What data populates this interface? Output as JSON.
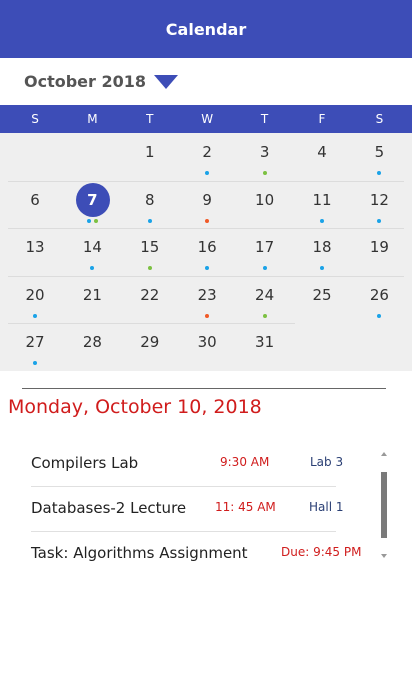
{
  "app": {
    "title": "Calendar"
  },
  "month": {
    "label": "October 2018"
  },
  "weekdays": [
    "S",
    "M",
    "T",
    "W",
    "T",
    "F",
    "S"
  ],
  "calendar": {
    "today": "7",
    "weeks": [
      [
        {
          "d": ""
        },
        {
          "d": ""
        },
        {
          "d": "1"
        },
        {
          "d": "2",
          "dots": [
            "#1aa3e8"
          ]
        },
        {
          "d": "3",
          "dots": [
            "#7cc142"
          ]
        },
        {
          "d": "4"
        },
        {
          "d": "5",
          "dots": [
            "#1aa3e8"
          ]
        }
      ],
      [
        {
          "d": "6"
        },
        {
          "d": "7",
          "dots": [
            "#1aa3e8",
            "#7cc142"
          ]
        },
        {
          "d": "8",
          "dots": [
            "#1aa3e8"
          ]
        },
        {
          "d": "9",
          "dots": [
            "#f05a28"
          ]
        },
        {
          "d": "10"
        },
        {
          "d": "11",
          "dots": [
            "#1aa3e8"
          ]
        },
        {
          "d": "12",
          "dots": [
            "#1aa3e8"
          ]
        }
      ],
      [
        {
          "d": "13"
        },
        {
          "d": "14",
          "dots": [
            "#1aa3e8"
          ]
        },
        {
          "d": "15",
          "dots": [
            "#7cc142"
          ]
        },
        {
          "d": "16",
          "dots": [
            "#1aa3e8"
          ]
        },
        {
          "d": "17",
          "dots": [
            "#1aa3e8"
          ]
        },
        {
          "d": "18",
          "dots": [
            "#1aa3e8"
          ]
        },
        {
          "d": "19"
        }
      ],
      [
        {
          "d": "20",
          "dots": [
            "#1aa3e8"
          ]
        },
        {
          "d": "21"
        },
        {
          "d": "22"
        },
        {
          "d": "23",
          "dots": [
            "#f05a28"
          ]
        },
        {
          "d": "24",
          "dots": [
            "#7cc142"
          ]
        },
        {
          "d": "25"
        },
        {
          "d": "26",
          "dots": [
            "#1aa3e8"
          ]
        }
      ],
      [
        {
          "d": "27",
          "dots": [
            "#1aa3e8"
          ]
        },
        {
          "d": "28"
        },
        {
          "d": "29"
        },
        {
          "d": "30"
        },
        {
          "d": "31"
        },
        {
          "d": ""
        },
        {
          "d": ""
        }
      ]
    ]
  },
  "selected_date": "Monday, October 10, 2018",
  "events": [
    {
      "title": "Compilers Lab",
      "time": "9:30 AM",
      "location": "Lab 3"
    },
    {
      "title": "Databases-2 Lecture",
      "time": "11: 45 AM",
      "location": "Hall 1"
    },
    {
      "title": "Task: Algorithms Assignment",
      "time": "Due: 9:45 PM",
      "location": ""
    }
  ],
  "colors": {
    "accent": "#3d4db7",
    "date_heading": "#d01c1c",
    "event_time": "#d01c1c",
    "event_location": "#2a3f74"
  }
}
